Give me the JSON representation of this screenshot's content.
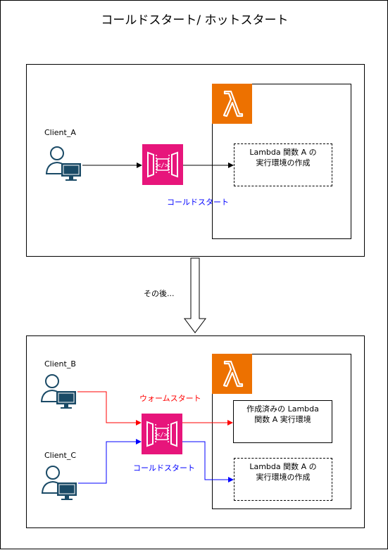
{
  "title": "コールドスタート/ ホットスタート",
  "top": {
    "client_a": "Client_A",
    "env_label": "Lambda 関数 A の\n実行環境の作成",
    "note": "コールドスタート"
  },
  "transition": "その後...",
  "bottom": {
    "client_b": "Client_B",
    "client_c": "Client_C",
    "warm_note": "ウォームスタート",
    "cold_note": "コールドスタート",
    "existing_env": "作成済みの Lambda\n関数 A 実行環境",
    "new_env": "Lambda 関数 A の\n実行環境の作成"
  },
  "colors": {
    "lambda": "#ed7100",
    "api_gateway": "#e7157b",
    "user_icon": "#1a4a66",
    "warm": "#ff0000",
    "cold": "#0000ff"
  },
  "icons": {
    "lambda": "lambda-icon",
    "api_gateway": "api-gateway-icon",
    "client": "user-computer-icon"
  }
}
